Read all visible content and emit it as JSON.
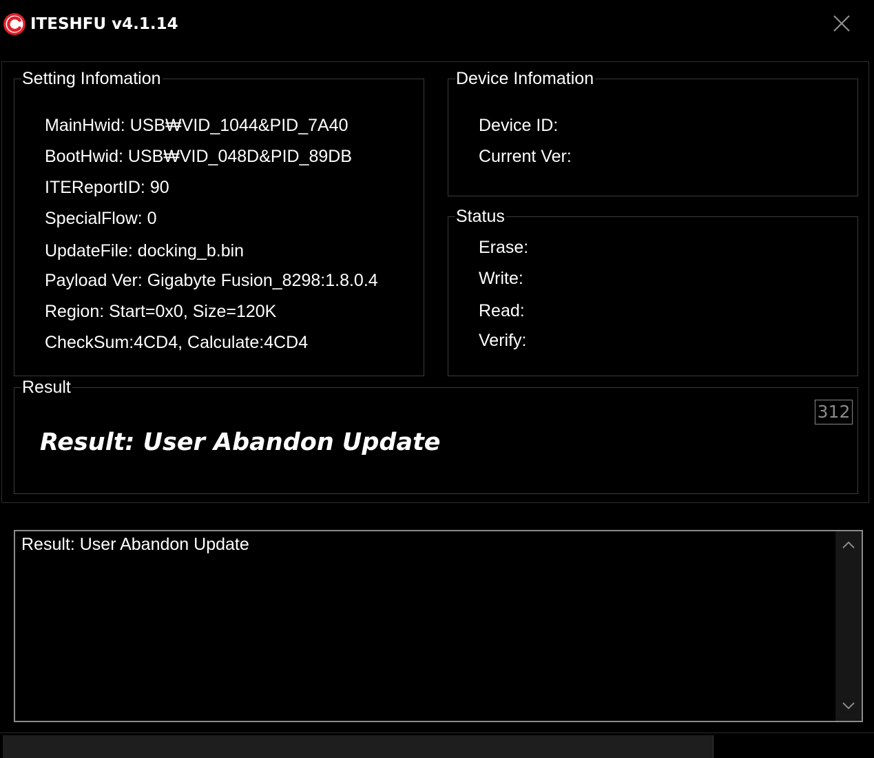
{
  "window": {
    "title": "ITESHFU v4.1.14",
    "logo_icon": "red-circle-c-logo-icon",
    "close_icon": "close-icon",
    "accent_color": "#e0202a"
  },
  "setting_info": {
    "title": "Setting Infomation",
    "main_hwid": "MainHwid: USB₩VID_1044&PID_7A40",
    "boot_hwid": "BootHwid: USB₩VID_048D&PID_89DB",
    "ite_report_id": "ITEReportID: 90",
    "special_flow": "SpecialFlow: 0",
    "update_file": "UpdateFile: docking_b.bin",
    "payload_ver": "Payload Ver: Gigabyte Fusion_8298:1.8.0.4",
    "region": "Region: Start=0x0, Size=120K",
    "checksum": "CheckSum:4CD4, Calculate:4CD4"
  },
  "device_info": {
    "title": "Device Infomation",
    "device_id": "Device ID:",
    "current_ver": "Current Ver:"
  },
  "status": {
    "title": "Status",
    "erase": "Erase:",
    "write": "Write:",
    "read": "Read:",
    "verify": "Verify:"
  },
  "result": {
    "title": "Result",
    "counter": "312",
    "headline": "Result: User Abandon Update"
  },
  "log": {
    "text": "Result: User Abandon Update",
    "scroll_up_icon": "chevron-up-icon",
    "scroll_down_icon": "chevron-down-icon"
  },
  "progress": {
    "value_percent": 0
  }
}
